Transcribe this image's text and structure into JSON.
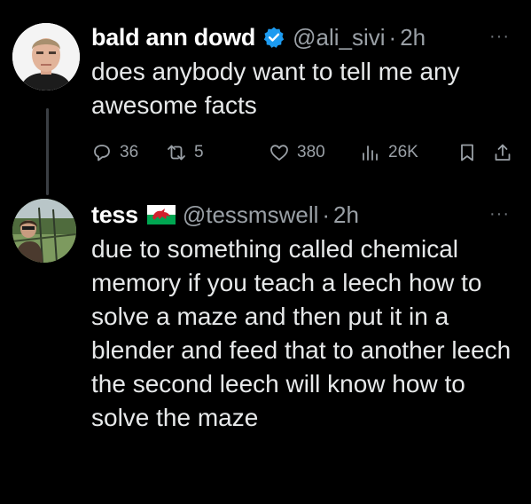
{
  "tweets": [
    {
      "name": "bald ann dowd",
      "handle": "@ali_sivi",
      "separator": "·",
      "time": "2h",
      "more": "···",
      "text": "does anybody want to tell me any awesome facts",
      "verified": true,
      "actions": {
        "replies": "36",
        "retweets": "5",
        "likes": "380",
        "views": "26K"
      }
    },
    {
      "name": "tess",
      "handle": "@tessmswell",
      "separator": "·",
      "time": "2h",
      "more": "···",
      "text": "due to something called chemical memory if you teach a leech how to solve a maze and then put it in a blender and feed that to another leech the second leech will know how to solve the maze"
    }
  ],
  "colors": {
    "background": "#000000",
    "text": "#e7e9ea",
    "muted": "#71767b",
    "verified": "#1d9bf0",
    "thread_line": "#3b3f44"
  },
  "icons": [
    "verified-badge-icon",
    "wales-flag-icon",
    "reply-icon",
    "retweet-icon",
    "like-icon",
    "views-icon",
    "bookmark-icon",
    "share-icon",
    "more-icon"
  ]
}
